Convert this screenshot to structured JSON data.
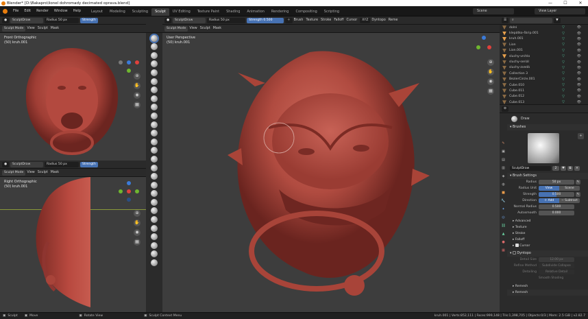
{
  "window": {
    "title": "Blender* [D:\\Bakapro\\lionel dohromady decimated oprava.blend]",
    "minimize": "—",
    "maximize": "☐",
    "close": "✕"
  },
  "menubar": {
    "items": [
      "File",
      "Edit",
      "Render",
      "Window",
      "Help"
    ],
    "workspaces": [
      "Layout",
      "Modeling",
      "Sculpting",
      "Sculpt",
      "UV Editing",
      "Texture Paint",
      "Shading",
      "Animation",
      "Rendering",
      "Compositing",
      "Scripting"
    ],
    "active_workspace": "Sculpt",
    "scene": "Scene",
    "view_layer": "View Layer"
  },
  "left_top_viewport": {
    "brush_name": "SculptDraw",
    "radius_label": "Radius",
    "radius_value": "50 px",
    "strength_label": "Strength",
    "mode": "Sculpt Mode",
    "menus": [
      "View",
      "Sculpt",
      "Mask"
    ],
    "view_name": "Front Orthographic",
    "object_name": "(50) kruh.001"
  },
  "left_bottom_viewport": {
    "brush_name": "SculptDraw",
    "radius_label": "Radius",
    "radius_value": "50 px",
    "strength_label": "Strength",
    "mode": "Sculpt Mode",
    "menus": [
      "View",
      "Sculpt",
      "Mask"
    ],
    "view_name": "Right Orthographic",
    "object_name": "(50) kruh.001"
  },
  "main_viewport": {
    "brush_name": "SculptDraw",
    "radius_label": "Radius",
    "radius_value": "50 px",
    "strength_label": "Strength",
    "strength_value": "0.500",
    "header_menus": [
      "Brush",
      "Texture",
      "Stroke",
      "Falloff",
      "Cursor"
    ],
    "dyntopo": "Dyntopo",
    "remesh": "Reme",
    "mode": "Sculpt Mode",
    "menus": [
      "View",
      "Sculpt",
      "Mask"
    ],
    "view_name": "User Perspective",
    "object_name": "(50) kruh.001"
  },
  "outliner": {
    "rows": [
      {
        "name": "dolní",
        "active": false
      },
      {
        "name": "klepátko-škrip.001",
        "active": true
      },
      {
        "name": "kruh.001",
        "active": true
      },
      {
        "name": "Lion",
        "active": false
      },
      {
        "name": "Lion.001",
        "active": false
      },
      {
        "name": "sluchy-vrchlo",
        "active": true
      },
      {
        "name": "sluchy-seriál",
        "active": false
      },
      {
        "name": "sluchy-zvedá",
        "active": false
      },
      {
        "name": "Collection 3",
        "active": false
      },
      {
        "name": "BezierCircle.001",
        "active": false
      },
      {
        "name": "Cube.010",
        "active": false
      },
      {
        "name": "Cube.011",
        "active": false
      },
      {
        "name": "Cube.012",
        "active": false
      },
      {
        "name": "Cube.013",
        "active": false
      }
    ]
  },
  "properties": {
    "tool_name": "Draw",
    "brushes_header": "Brushes",
    "brush_name": "SculptDraw",
    "brush_users": "2",
    "brush_settings_header": "Brush Settings",
    "radius_label": "Radius",
    "radius_value": "50 px",
    "radius_unit_label": "Radius Unit",
    "radius_unit_view": "View",
    "radius_unit_scene": "Scene",
    "strength_label": "Strength",
    "strength_value": "0.500",
    "direction_label": "Direction",
    "direction_add": "Add",
    "direction_subtract": "Subtract",
    "normal_radius_label": "Normal Radius",
    "normal_radius_value": "0.500",
    "autosmooth_label": "Autosmooth",
    "autosmooth_value": "0.000",
    "subsections": [
      "Advanced",
      "Texture",
      "Stroke",
      "Falloff"
    ],
    "cursor_label": "Cursor",
    "dyntopo_header": "Dyntopo",
    "detail_size_label": "Detail Size",
    "detail_size_value": "12.00 px",
    "refine_method_label": "Refine Method",
    "refine_method_value": "Subdivide Collapse",
    "detailing_label": "Detailing",
    "detailing_value": "Relative Detail",
    "smooth_shading": "Smooth Shading",
    "remesh_header": "Remesh",
    "remesh_footer": "Remesh"
  },
  "statusbar": {
    "left": [
      "Sculpt",
      "Move",
      "Rotate View",
      "Sculpt Context Menu"
    ],
    "stats": "kruh.001 | Verts:852,111 | Faces:999,148 | Tris:1,398,705 | Objects:0/3 | Mem: 2.5 GiB | v2.82.7"
  },
  "colors": {
    "accent": "#4772b3",
    "model": "#b54a3f",
    "viewport": "#3d3d3d"
  }
}
